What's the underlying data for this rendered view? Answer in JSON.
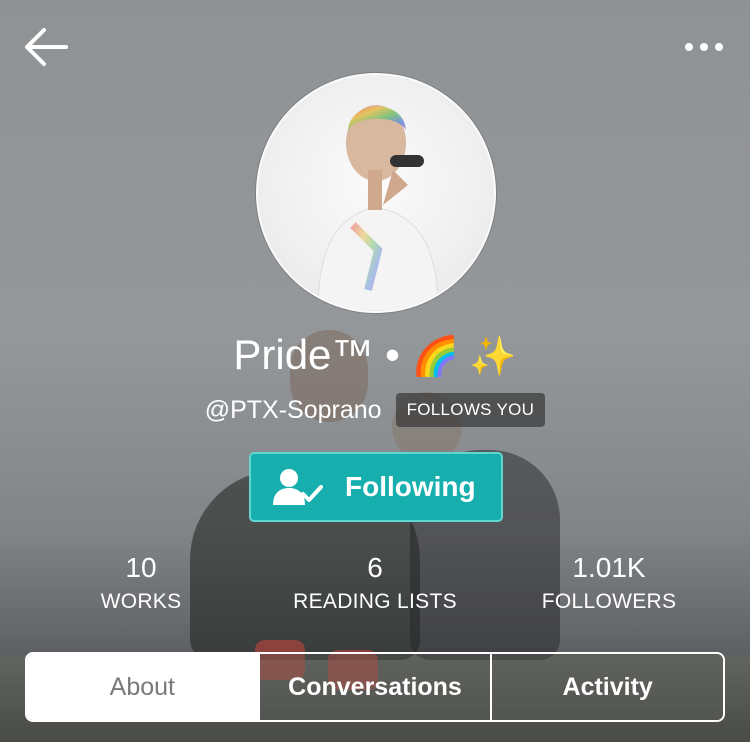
{
  "header": {
    "back_icon": "arrow-left-icon",
    "more_icon": "more-horizontal-icon"
  },
  "profile": {
    "display_name": "Pride™ •",
    "name_emoji": "🌈 ✨",
    "handle": "@PTX-Soprano",
    "follows_you_badge": "FOLLOWS YOU",
    "follow_button_label": "Following",
    "follow_button_icon": "user-check-icon",
    "accent_color": "#16afae"
  },
  "stats": [
    {
      "value": "10",
      "label": "WORKS"
    },
    {
      "value": "6",
      "label": "READING LISTS"
    },
    {
      "value": "1.01K",
      "label": "FOLLOWERS"
    }
  ],
  "tabs": [
    {
      "label": "About",
      "active": true
    },
    {
      "label": "Conversations",
      "active": false
    },
    {
      "label": "Activity",
      "active": false
    }
  ]
}
